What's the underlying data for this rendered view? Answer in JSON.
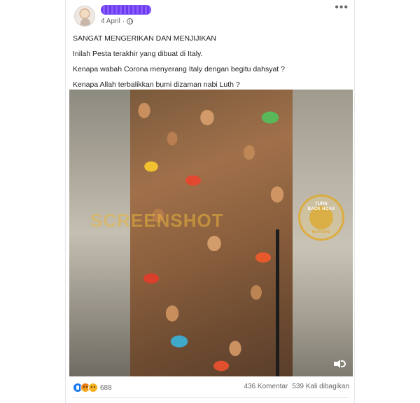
{
  "post": {
    "author_redacted": true,
    "date": "4 April",
    "privacy_icon": "globe-icon",
    "more_icon": "more-horizontal-icon",
    "caption": [
      "SANGAT MENGERIKAN DAN MENJIJIKAN",
      "Inilah Pesta terakhir yang dibuat di Italy.",
      "Kenapa wabah Corona menyerang Italy dengan begitu dahsyat ?",
      "Kenapa Allah terbalikkan bumi dizaman nabi Luth ?"
    ],
    "media": {
      "type": "video",
      "watermark_text": "SCREENSHOT",
      "seal": {
        "line1": "TURN",
        "line2": "BACK HOAX",
        "ring": "MAFINDO"
      },
      "sound_icon": "speaker-icon"
    },
    "footer": {
      "reactions": [
        "like-reaction-icon",
        "angry-reaction-icon",
        "sad-reaction-icon"
      ],
      "reaction_count": "688",
      "comments": "436 Komentar",
      "shares": "539 Kali dibagikan"
    }
  },
  "colors": {
    "text_primary": "#1c1e21",
    "text_secondary": "#65676b",
    "like_blue": "#1877f2",
    "redaction_purple": "#7b4ff5",
    "seal_gold": "#dea828"
  }
}
